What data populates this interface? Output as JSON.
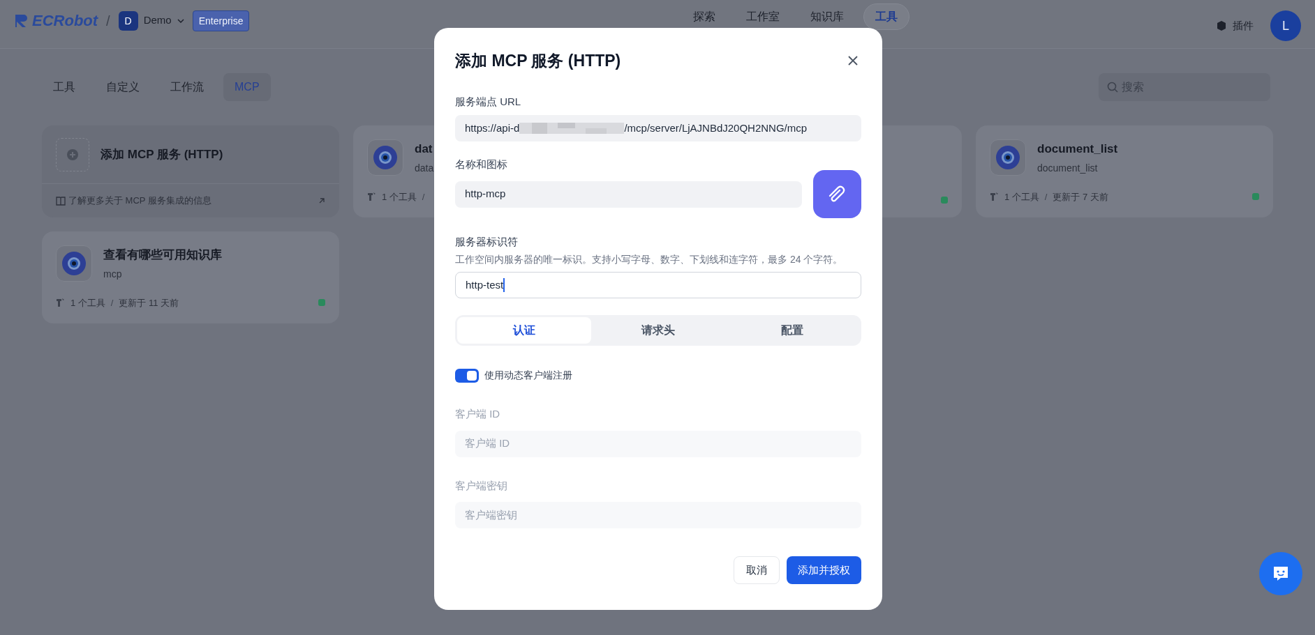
{
  "header": {
    "logo_text": "ECRobot",
    "separator": "/",
    "workspace": {
      "initial": "D",
      "name": "Demo",
      "plan": "Enterprise"
    },
    "nav": [
      {
        "label": "探索",
        "selected": false
      },
      {
        "label": "工作室",
        "selected": false
      },
      {
        "label": "知识库",
        "selected": false
      },
      {
        "label": "工具",
        "selected": true
      }
    ],
    "plugins": "插件",
    "avatar": "L"
  },
  "tabs": [
    {
      "label": "工具",
      "selected": false
    },
    {
      "label": "自定义",
      "selected": false
    },
    {
      "label": "工作流",
      "selected": false
    },
    {
      "label": "MCP",
      "selected": true
    }
  ],
  "search": {
    "placeholder": "搜索"
  },
  "add_card": {
    "title": "添加 MCP 服务 (HTTP)",
    "link": "了解更多关于 MCP 服务集成的信息"
  },
  "cards": [
    {
      "name": "dat",
      "subtitle": "data",
      "tools": "1 个工具",
      "separator": "/"
    },
    {
      "color": "#2a8a5c"
    },
    {
      "name": "document_list",
      "subtitle": "document_list",
      "tools": "1 个工具",
      "separator": "/",
      "updated": "更新于 7 天前",
      "color": "#2a8a5c"
    },
    {
      "name": "查看有哪些可用知识库",
      "subtitle": "mcp",
      "tools": "1 个工具",
      "separator": "/",
      "updated": "更新于 11 天前",
      "color": "#2a8a5c"
    }
  ],
  "modal": {
    "title": "添加 MCP 服务 (HTTP)",
    "url": {
      "label": "服务端点 URL",
      "value_start": "https://api-d",
      "value_end": "/mcp/server/LjAJNBdJ20QH2NNG/mcp"
    },
    "name": {
      "label": "名称和图标",
      "value": "http-mcp"
    },
    "identifier": {
      "label": "服务器标识符",
      "hint": "工作空间内服务器的唯一标识。支持小写字母、数字、下划线和连字符，最多 24 个字符。",
      "value": "http-test"
    },
    "tabs": [
      {
        "label": "认证",
        "selected": true
      },
      {
        "label": "请求头",
        "selected": false
      },
      {
        "label": "配置",
        "selected": false
      }
    ],
    "toggle": {
      "label": "使用动态客户端注册",
      "on": true
    },
    "client_id": {
      "label": "客户端 ID",
      "placeholder": "客户端 ID"
    },
    "client_secret": {
      "label": "客户端密钥",
      "placeholder": "客户端密钥"
    },
    "buttons": {
      "cancel": "取消",
      "submit": "添加并授权"
    }
  }
}
